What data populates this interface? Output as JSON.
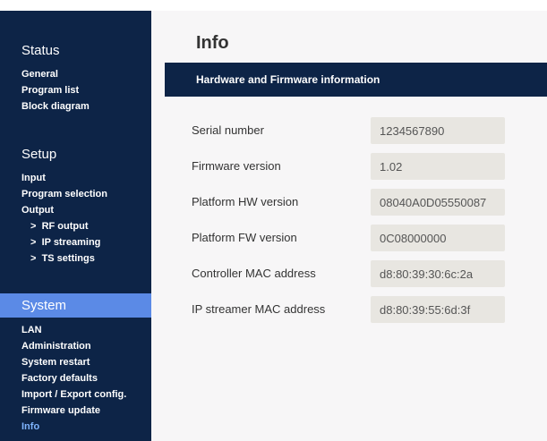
{
  "sidebar": {
    "status": {
      "title": "Status",
      "items": [
        "General",
        "Program list",
        "Block diagram"
      ]
    },
    "setup": {
      "title": "Setup",
      "items": [
        "Input",
        "Program selection",
        "Output"
      ],
      "subitems": [
        "RF output",
        "IP streaming",
        "TS settings"
      ],
      "sub_prefix": ">"
    },
    "system": {
      "title": "System",
      "items": [
        "LAN",
        "Administration",
        "System restart",
        "Factory defaults",
        "Import / Export config.",
        "Firmware update",
        "Info"
      ],
      "active_item": "Info"
    }
  },
  "main": {
    "title": "Info",
    "section_header": "Hardware and Firmware information",
    "fields": [
      {
        "label": "Serial number",
        "value": "1234567890"
      },
      {
        "label": "Firmware version",
        "value": "1.02"
      },
      {
        "label": "Platform HW version",
        "value": "08040A0D05550087"
      },
      {
        "label": "Platform FW version",
        "value": "0C08000000"
      },
      {
        "label": "Controller MAC address",
        "value": "d8:80:39:30:6c:2a"
      },
      {
        "label": "IP streamer MAC address",
        "value": "d8:80:39:55:6d:3f"
      }
    ]
  },
  "colors": {
    "sidebar_bg": "#0d2447",
    "system_highlight": "#5b8ae6",
    "active_link": "#7fb4ff",
    "content_bg": "#f7f6f7",
    "field_bg": "#e8e6e1"
  }
}
